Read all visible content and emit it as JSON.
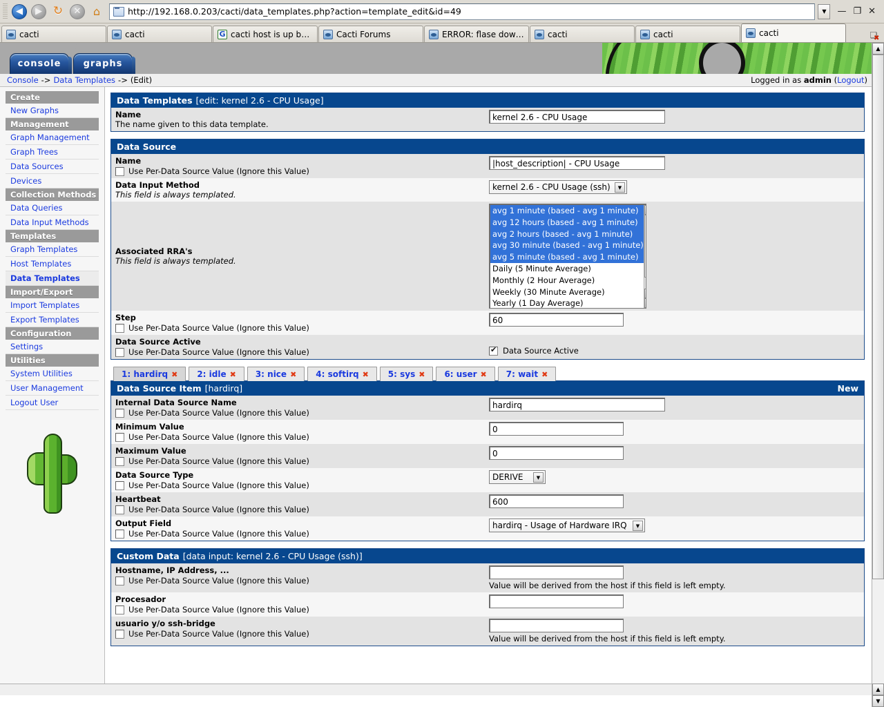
{
  "browser": {
    "url": "http://192.168.0.203/cacti/data_templates.php?action=template_edit&id=49",
    "nav": {
      "back": "◀",
      "forward": "▶",
      "reload": "↻",
      "stop": "✕",
      "home": "⌂"
    },
    "window_controls": {
      "minimize": "—",
      "restore": "❐",
      "close": "✕"
    },
    "tabs": [
      {
        "title": "cacti",
        "icon": "cacti-favicon",
        "active": false
      },
      {
        "title": "cacti",
        "icon": "cacti-favicon",
        "active": false
      },
      {
        "title": "cacti host is up but ...",
        "icon": "google-favicon",
        "active": false
      },
      {
        "title": "Cacti Forums",
        "icon": "cacti-favicon",
        "active": false
      },
      {
        "title": "ERROR: flase down s...",
        "icon": "cacti-favicon",
        "active": false
      },
      {
        "title": "cacti",
        "icon": "cacti-favicon",
        "active": false
      },
      {
        "title": "cacti",
        "icon": "cacti-favicon",
        "active": false
      },
      {
        "title": "cacti",
        "icon": "cacti-favicon",
        "active": true
      }
    ]
  },
  "topnav": {
    "console": "console",
    "graphs": "graphs"
  },
  "breadcrumb": {
    "console": "Console",
    "sep1": "->",
    "data_templates": "Data Templates",
    "sep2": "->",
    "current": "(Edit)",
    "logged_in_prefix": "Logged in as",
    "logged_in_user": "admin",
    "logout_open": "(",
    "logout": "Logout",
    "logout_close": ")"
  },
  "sidebar": {
    "sections": [
      {
        "header": "Create",
        "items": [
          "New Graphs"
        ]
      },
      {
        "header": "Management",
        "items": [
          "Graph Management",
          "Graph Trees",
          "Data Sources",
          "Devices"
        ]
      },
      {
        "header": "Collection Methods",
        "items": [
          "Data Queries",
          "Data Input Methods"
        ]
      },
      {
        "header": "Templates",
        "items": [
          "Graph Templates",
          "Host Templates",
          "Data Templates"
        ]
      },
      {
        "header": "Import/Export",
        "items": [
          "Import Templates",
          "Export Templates"
        ]
      },
      {
        "header": "Configuration",
        "items": [
          "Settings"
        ]
      },
      {
        "header": "Utilities",
        "items": [
          "System Utilities",
          "User Management",
          "Logout User"
        ]
      }
    ],
    "current_item": "Data Templates"
  },
  "per_ds_checkbox_label": "Use Per-Data Source Value (Ignore this Value)",
  "panels": {
    "data_templates": {
      "title": "Data Templates",
      "subtitle": "[edit: kernel 2.6 - CPU Usage]",
      "name_label": "Name",
      "name_desc": "The name given to this data template.",
      "name_value": "kernel 2.6 - CPU Usage"
    },
    "data_source": {
      "title": "Data Source",
      "rows": {
        "name": {
          "label": "Name",
          "value": "|host_description| - CPU Usage"
        },
        "data_input_method": {
          "label": "Data Input Method",
          "desc": "This field is always templated.",
          "value": "kernel 2.6 - CPU Usage (ssh)"
        },
        "associated_rras": {
          "label": "Associated RRA's",
          "desc": "This field is always templated.",
          "options": [
            {
              "text": "avg 1 minute (based - avg 1 minute)",
              "selected": true
            },
            {
              "text": "avg 12 hours (based - avg 1 minute)",
              "selected": true
            },
            {
              "text": "avg 2 hours (based - avg 1 minute)",
              "selected": true
            },
            {
              "text": "avg 30 minute (based - avg 1 minute)",
              "selected": true
            },
            {
              "text": "avg 5 minute (based - avg 1 minute)",
              "selected": true
            },
            {
              "text": "Daily (5 Minute Average)",
              "selected": false
            },
            {
              "text": "Monthly (2 Hour Average)",
              "selected": false
            },
            {
              "text": "Weekly (30 Minute Average)",
              "selected": false
            },
            {
              "text": "Yearly (1 Day Average)",
              "selected": false
            }
          ]
        },
        "step": {
          "label": "Step",
          "value": "60"
        },
        "data_source_active": {
          "label": "Data Source Active",
          "checkbox_label": "Data Source Active",
          "checked": true
        }
      }
    },
    "data_source_item": {
      "tabs": [
        {
          "label": "1: hardirq",
          "close": "✖",
          "active": true
        },
        {
          "label": "2: idle",
          "close": "✖",
          "active": false
        },
        {
          "label": "3: nice",
          "close": "✖",
          "active": false
        },
        {
          "label": "4: softirq",
          "close": "✖",
          "active": false
        },
        {
          "label": "5: sys",
          "close": "✖",
          "active": false
        },
        {
          "label": "6: user",
          "close": "✖",
          "active": false
        },
        {
          "label": "7: wait",
          "close": "✖",
          "active": false
        }
      ],
      "title": "Data Source Item",
      "subtitle": "[hardirq]",
      "new_link": "New",
      "rows": {
        "internal_name": {
          "label": "Internal Data Source Name",
          "value": "hardirq"
        },
        "minimum": {
          "label": "Minimum Value",
          "value": "0"
        },
        "maximum": {
          "label": "Maximum Value",
          "value": "0"
        },
        "type": {
          "label": "Data Source Type",
          "value": "DERIVE"
        },
        "heartbeat": {
          "label": "Heartbeat",
          "value": "600"
        },
        "output_field": {
          "label": "Output Field",
          "value": "hardirq - Usage of Hardware IRQ"
        }
      }
    },
    "custom_data": {
      "title": "Custom Data",
      "subtitle": "[data input: kernel 2.6 - CPU Usage (ssh)]",
      "derived_hint": "Value will be derived from the host if this field is left empty.",
      "rows": [
        {
          "label": "Hostname, IP Address, ...",
          "value": "",
          "hint": true
        },
        {
          "label": "Procesador",
          "value": "",
          "hint": false
        },
        {
          "label": "usuario y/o ssh-bridge",
          "value": "",
          "hint": true
        }
      ]
    }
  },
  "colors": {
    "panel_header": "#07478e",
    "link": "#1a3adf",
    "selection": "#3272d8",
    "sidebar_header": "#9a9a9a",
    "close_x": "#e03a14"
  }
}
